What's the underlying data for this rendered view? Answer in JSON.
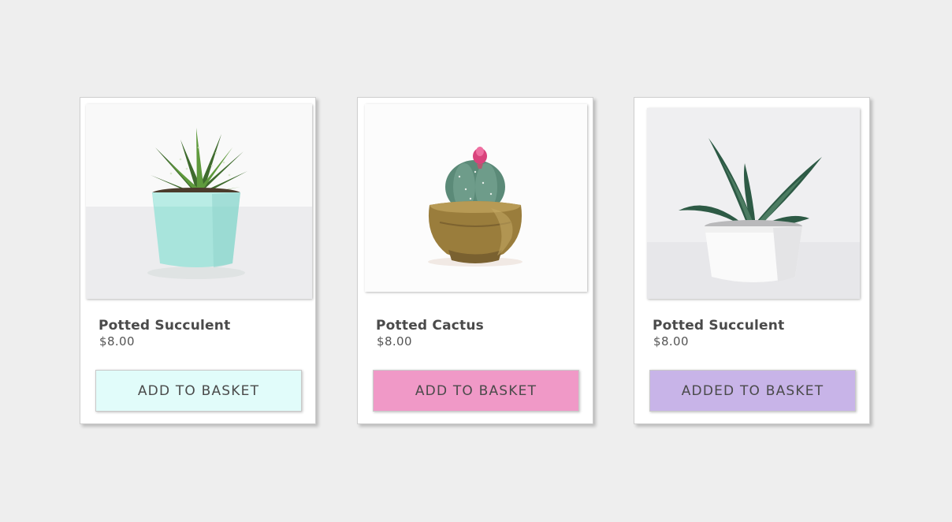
{
  "products": [
    {
      "name": "Potted Succulent",
      "price": "$8.00",
      "button_label": "ADD TO BASKET",
      "button_color": "#e1fcfa",
      "image_icon": "succulent-mint-pot-photo"
    },
    {
      "name": "Potted Cactus",
      "price": "$8.00",
      "button_label": "ADD TO BASKET",
      "button_color": "#f099c7",
      "image_icon": "cactus-brass-pot-photo"
    },
    {
      "name": "Potted Succulent",
      "price": "$8.00",
      "button_label": "ADDED TO BASKET",
      "button_color": "#c8b4e8",
      "image_icon": "succulent-white-pot-photo"
    }
  ],
  "page_background": "#eeeeee"
}
